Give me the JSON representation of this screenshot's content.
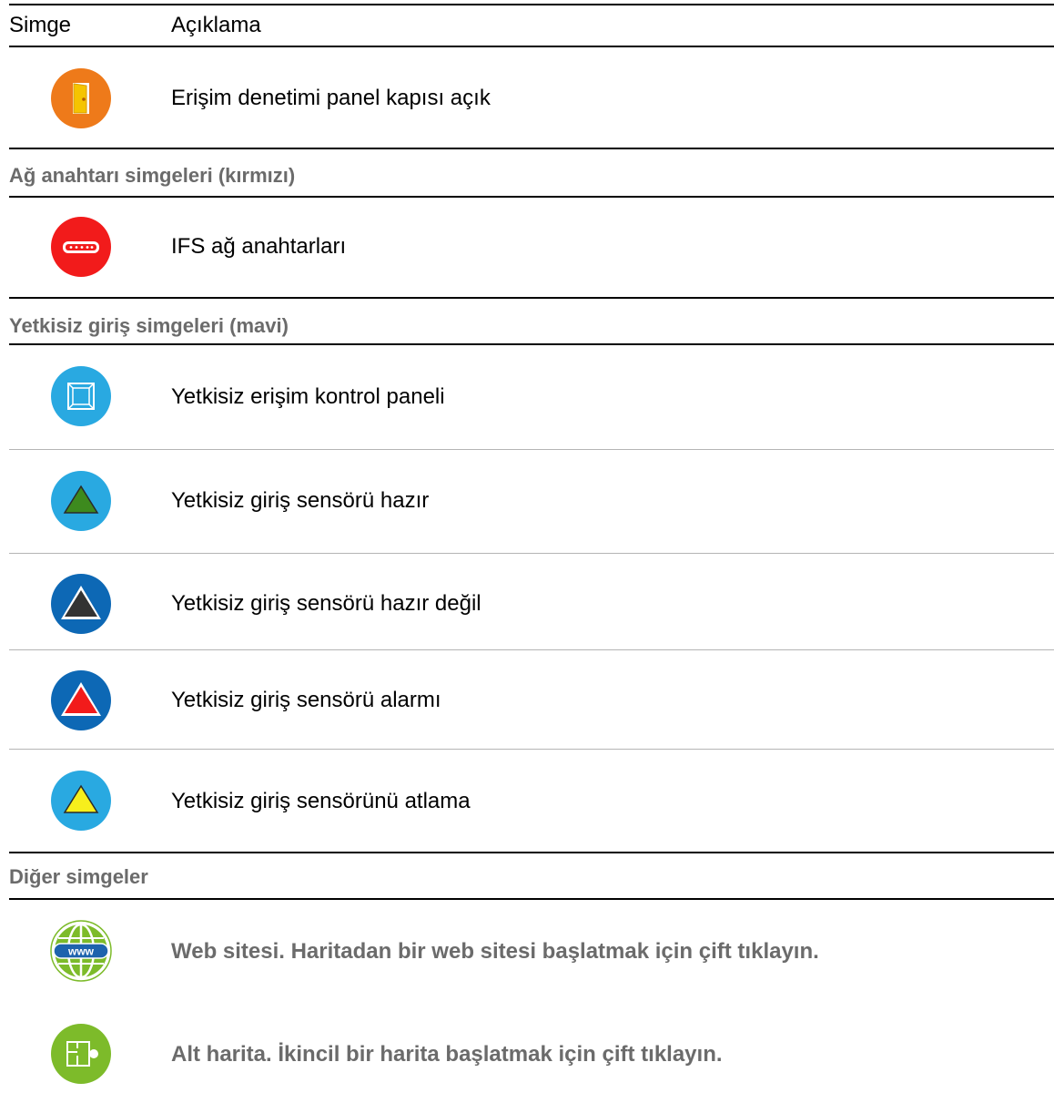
{
  "header": {
    "col_icon": "Simge",
    "col_desc": "Açıklama"
  },
  "rows": [
    {
      "icon": "door-open-icon",
      "text": "Erişim denetimi panel kapısı açık"
    }
  ],
  "sections": [
    {
      "title": "Ağ anahtarı simgeleri (kırmızı)",
      "rows": [
        {
          "icon": "network-switch-icon",
          "text": "IFS ağ anahtarları"
        }
      ]
    },
    {
      "title": "Yetkisiz giriş simgeleri (mavi)",
      "rows": [
        {
          "icon": "control-panel-icon",
          "text": "Yetkisiz erişim kontrol paneli"
        },
        {
          "icon": "sensor-ready-icon",
          "text": "Yetkisiz giriş sensörü hazır"
        },
        {
          "icon": "sensor-not-ready-icon",
          "text": "Yetkisiz giriş sensörü hazır değil"
        },
        {
          "icon": "sensor-alarm-icon",
          "text": "Yetkisiz giriş sensörü alarmı"
        },
        {
          "icon": "sensor-bypass-icon",
          "text": "Yetkisiz giriş sensörünü atlama"
        }
      ]
    },
    {
      "title": "Diğer simgeler",
      "rows": [
        {
          "icon": "website-globe-icon",
          "text": "Web sitesi. Haritadan bir web sitesi başlatmak için çift tıklayın."
        },
        {
          "icon": "submap-icon",
          "text": "Alt harita. İkincil bir harita başlatmak için çift tıklayın."
        }
      ]
    }
  ],
  "colors": {
    "door_orange": "#ee7a1a",
    "switch_red": "#f21b1b",
    "intrusion_blue": "#29a9e1",
    "intrusion_dark_blue": "#0d68b5",
    "submap_green": "#7dbb2a",
    "section_grey": "#6b6b6b"
  }
}
